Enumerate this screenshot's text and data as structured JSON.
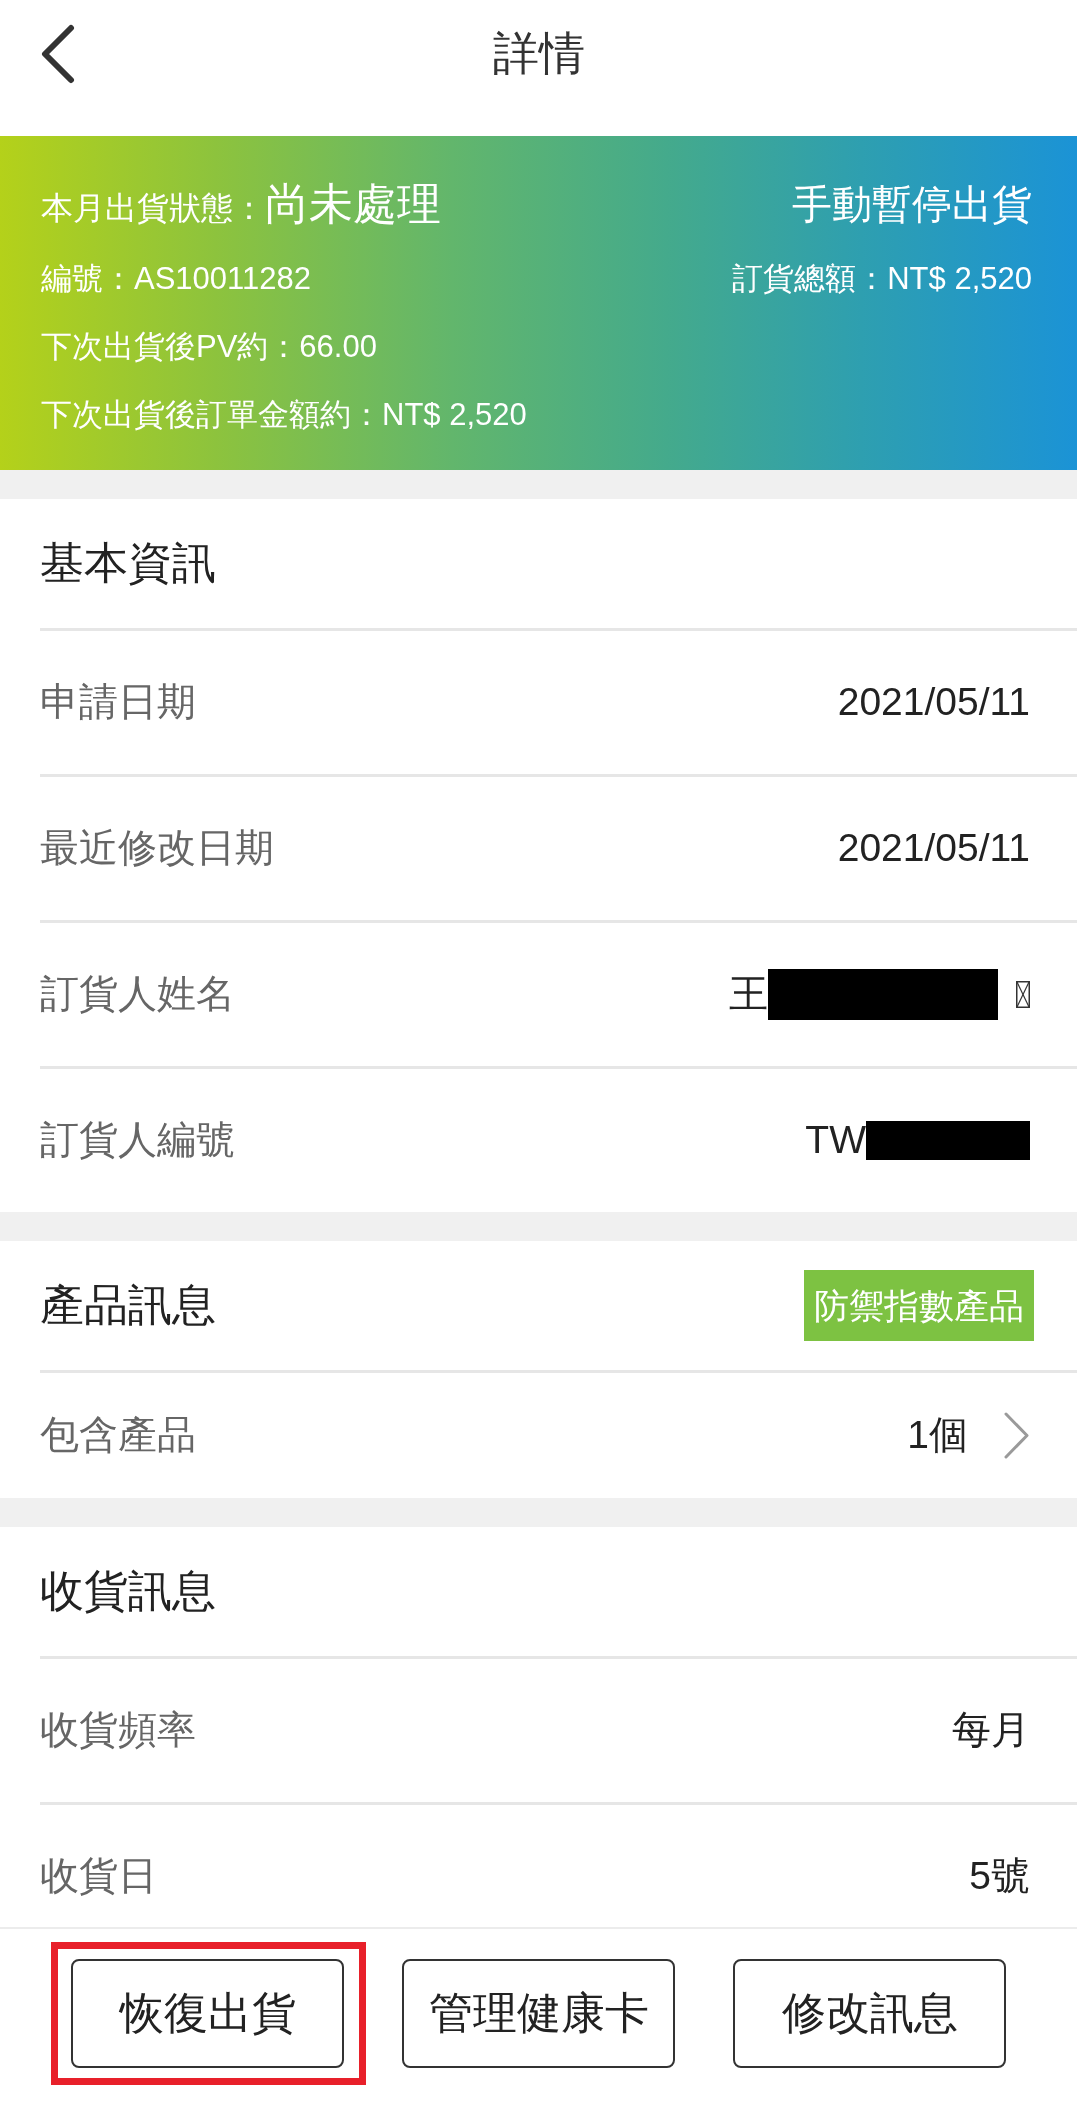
{
  "header": {
    "title": "詳情"
  },
  "status_banner": {
    "status_label": "本月出貨狀態：",
    "status_value": "尚未處理",
    "mode": "手動暫停出貨",
    "lines": [
      {
        "left": "編號：AS10011282",
        "right": "訂貨總額：NT$ 2,520"
      },
      {
        "left": "下次出貨後PV約：66.00"
      },
      {
        "left": "下次出貨後訂單金額約：NT$ 2,520"
      }
    ]
  },
  "sections": [
    {
      "title": "基本資訊",
      "rows": [
        {
          "kind": "text",
          "label": "申請日期",
          "value": "2021/05/11"
        },
        {
          "kind": "text",
          "label": "最近修改日期",
          "value": "2021/05/11"
        },
        {
          "kind": "redacted",
          "label": "訂貨人姓名",
          "value": "王",
          "missing_glyph": true
        },
        {
          "kind": "redacted",
          "label": "訂貨人編號",
          "value": "TW",
          "missing_glyph": false
        }
      ]
    },
    {
      "title": "產品訊息",
      "badge": "防禦指數產品",
      "rows": [
        {
          "kind": "link",
          "label": "包含產品",
          "value": "1個"
        }
      ]
    },
    {
      "title": "收貨訊息",
      "rows": [
        {
          "kind": "text",
          "label": "收貨頻率",
          "value": "每月"
        },
        {
          "kind": "text",
          "label": "收貨日",
          "value": "5號"
        }
      ]
    }
  ],
  "buttons": [
    {
      "label": "恢復出貨",
      "highlighted": true
    },
    {
      "label": "管理健康卡",
      "highlighted": false
    },
    {
      "label": "修改訊息",
      "highlighted": false
    }
  ]
}
